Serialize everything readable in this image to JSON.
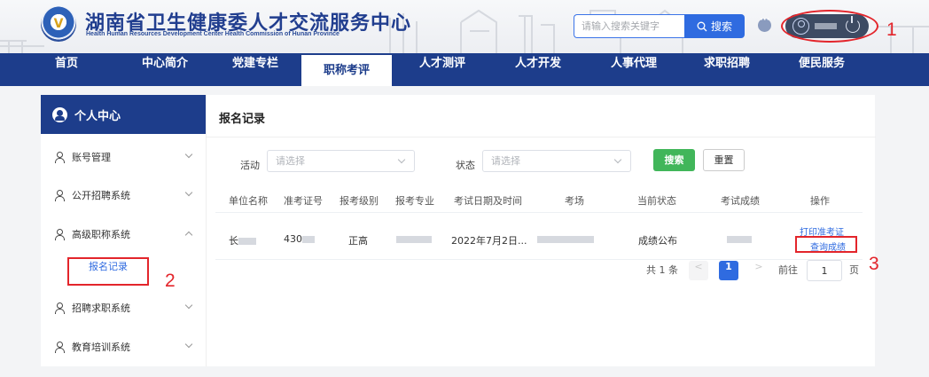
{
  "header": {
    "title": "湖南省卫生健康委人才交流服务中心",
    "subtitle": "Health Human Resources Development Center Health Commission of Hunan Province",
    "search_placeholder": "请输入搜索关键字",
    "search_label": "搜索"
  },
  "nav": {
    "items": [
      "首页",
      "中心简介",
      "党建专栏",
      "职称考评",
      "人才测评",
      "人才开发",
      "人事代理",
      "求职招聘",
      "便民服务"
    ]
  },
  "sidebar": {
    "title": "个人中心",
    "items": [
      {
        "label": "账号管理"
      },
      {
        "label": "公开招聘系统"
      },
      {
        "label": "高级职称系统"
      },
      {
        "label": "招聘求职系统"
      },
      {
        "label": "教育培训系统"
      }
    ],
    "sub_item": "报名记录"
  },
  "main": {
    "title": "报名记录",
    "filters": {
      "activity_label": "活动",
      "activity_placeholder": "请选择",
      "status_label": "状态",
      "status_placeholder": "请选择",
      "search_btn": "搜索",
      "reset_btn": "重置"
    },
    "table": {
      "headers": [
        "单位名称",
        "准考证号",
        "报考级别",
        "报考专业",
        "考试日期及时间",
        "考场",
        "当前状态",
        "考试成绩",
        "操作"
      ],
      "row": {
        "unit": "长",
        "exam_no": "430",
        "level": "正高",
        "date": "2022年7月2日...",
        "status": "成绩公布",
        "actions": [
          "打印准考证",
          "查询成绩"
        ]
      }
    },
    "pager": {
      "total": "共 1 条",
      "prev": "<",
      "current": "1",
      "next": ">",
      "goto": "前往",
      "page_value": "1",
      "page_unit": "页"
    }
  },
  "annotations": [
    "1",
    "2",
    "3"
  ],
  "colors": {
    "brand_blue": "#1d3d8b",
    "accent_blue": "#2f6be0",
    "green": "#41b65a",
    "annotation_red": "#e3252b"
  }
}
